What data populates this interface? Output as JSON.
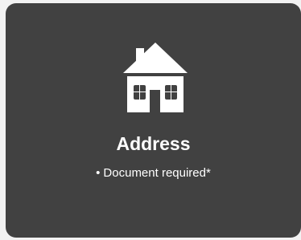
{
  "card": {
    "icon": "house-icon",
    "title": "Address",
    "bullet": "•",
    "requirement": "Document required*"
  },
  "colors": {
    "page_background": "#f2f2f2",
    "card_background": "#414141",
    "foreground": "#ffffff"
  }
}
